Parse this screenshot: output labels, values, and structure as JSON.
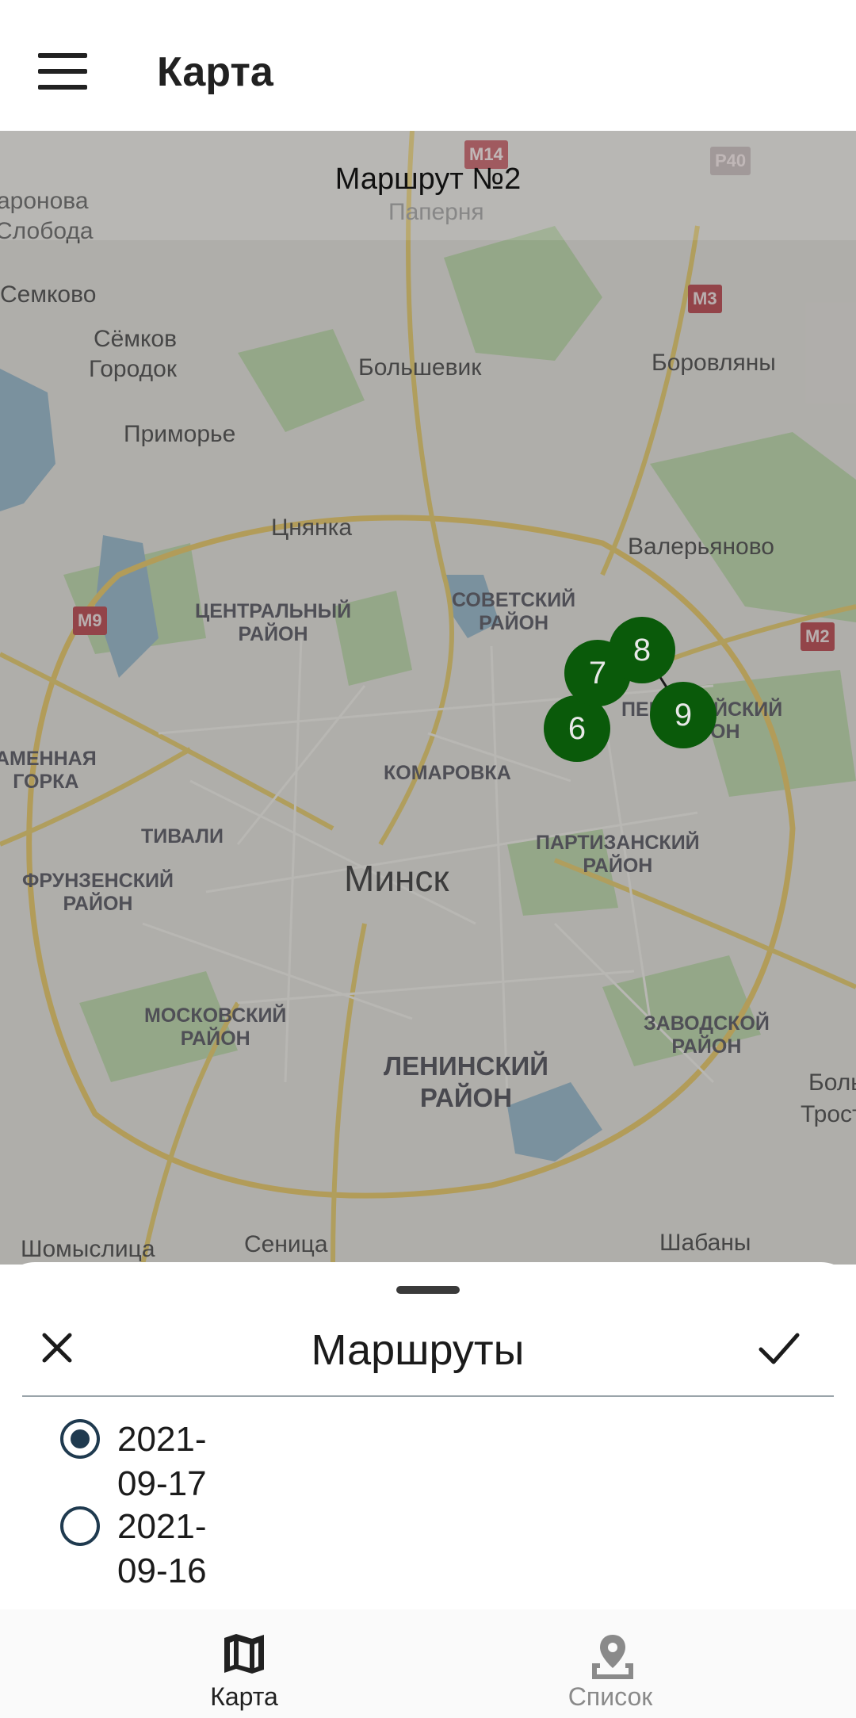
{
  "app_bar": {
    "title": "Карта",
    "menu_icon": "hamburger-menu-icon"
  },
  "map": {
    "route_title": "Маршрут №2",
    "city": "Минск",
    "places": [
      "аронова",
      "Слобода",
      "Семково",
      "Сёмков",
      "Городок",
      "Большевик",
      "Приморье",
      "Боровляны",
      "Цнянка",
      "Валерьяново",
      "Паперня",
      "Шомыслица",
      "Сеница",
      "Шабаны",
      "Больш",
      "Тросте"
    ],
    "districts": {
      "central": [
        "ЦЕНТРАЛЬНЫЙ",
        "РАЙОН"
      ],
      "sovetsky": [
        "СОВЕТСКИЙ",
        "РАЙОН"
      ],
      "pervomaisky": [
        "ПЕР",
        "ЙСКИЙ",
        "ОН"
      ],
      "komarovka": "КОМАРОВКА",
      "kamennaya_gorka": [
        "АМЕННАЯ",
        "ГОРКА"
      ],
      "tivali": "ТИВАЛИ",
      "partizansky": [
        "ПАРТИЗАНСКИЙ",
        "РАЙОН"
      ],
      "frunzensky": [
        "ФРУНЗЕНСКИЙ",
        "РАЙОН"
      ],
      "moskovsky": [
        "МОСКОВСКИЙ",
        "РАЙОН"
      ],
      "zavodskoy": [
        "ЗАВОДСКОЙ",
        "РАЙОН"
      ],
      "leninsky": [
        "ЛЕНИНСКИЙ",
        "РАЙОН"
      ]
    },
    "road_shields": [
      "M14",
      "P40",
      "M3",
      "M9",
      "M2"
    ],
    "markers": [
      "6",
      "7",
      "8",
      "9"
    ],
    "marker_color": "#0a5a0a"
  },
  "sheet": {
    "title": "Маршруты",
    "close_icon": "close-icon",
    "confirm_icon": "check-icon",
    "options": [
      {
        "label": "2021-09-17",
        "selected": true
      },
      {
        "label": "2021-09-16",
        "selected": false
      }
    ]
  },
  "nav": {
    "items": [
      {
        "label": "Карта",
        "icon": "map-icon",
        "active": true
      },
      {
        "label": "Список",
        "icon": "location-pin-icon",
        "active": false
      }
    ],
    "active_color": "#212121",
    "inactive_color": "#8a8a8a"
  }
}
